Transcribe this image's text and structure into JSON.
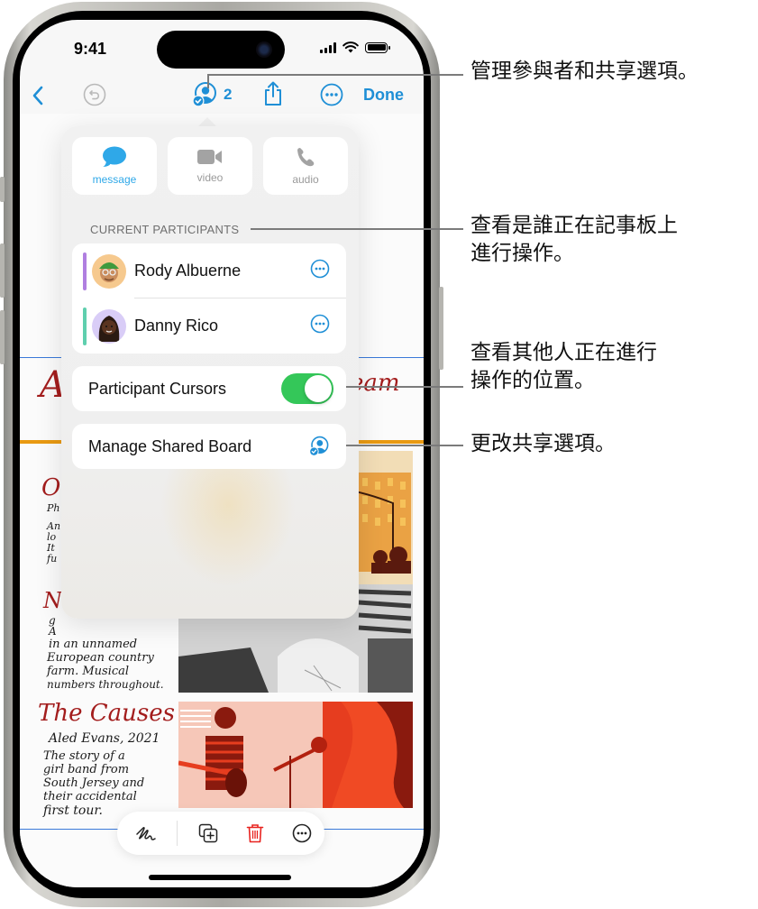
{
  "status_bar": {
    "time": "9:41",
    "icons": [
      "cellular-signal-icon",
      "wifi-icon",
      "battery-icon"
    ]
  },
  "nav_bar": {
    "back_icon": "chevron-left-icon",
    "undo_icon": "undo-icon",
    "collab_icon": "person-crop-circle-badge-checkmark-icon",
    "participant_count": "2",
    "share_icon": "share-icon",
    "more_icon": "ellipsis-circle-icon",
    "done_label": "Done"
  },
  "popover": {
    "communication_buttons": [
      {
        "label": "message",
        "icon": "message-bubble-icon",
        "active": true
      },
      {
        "label": "video",
        "icon": "video-camera-icon",
        "active": false
      },
      {
        "label": "audio",
        "icon": "phone-icon",
        "active": false
      }
    ],
    "participants_header": "CURRENT PARTICIPANTS",
    "participants": [
      {
        "name": "Rody Albuerne",
        "color": "#b07fe0",
        "avatar_bg": "#f6c98e",
        "more_icon": "ellipsis-circle-icon"
      },
      {
        "name": "Danny Rico",
        "color": "#5fcfae",
        "avatar_bg": "#d9cdf7",
        "more_icon": "ellipsis-circle-icon"
      }
    ],
    "participant_cursors": {
      "label": "Participant Cursors",
      "enabled": true
    },
    "manage_shared_board": {
      "label": "Manage Shared Board",
      "icon": "person-crop-circle-badge-checkmark-icon"
    }
  },
  "board": {
    "headings": [
      "A",
      "eam",
      "O",
      "N.",
      "The Causes"
    ],
    "notes": {
      "o_lines": [
        "Ph",
        "An",
        "lo",
        "It",
        "fu"
      ],
      "n_lines": [
        "g",
        "A",
        "in an unnamed",
        "European country",
        "farm. Musical",
        "numbers throughout."
      ],
      "causes_author": "Aled Evans, 2021",
      "causes_lines": [
        "The story of a",
        "girl band from",
        "South Jersey and",
        "their accidental",
        "first tour."
      ]
    }
  },
  "bottom_toolbar": {
    "items": [
      {
        "icon": "scribble-pen-icon"
      },
      {
        "icon": "duplicate-plus-icon"
      },
      {
        "icon": "trash-icon"
      },
      {
        "icon": "ellipsis-circle-icon"
      }
    ]
  },
  "callouts": [
    {
      "text": "管理參與者和共享選項。"
    },
    {
      "text": "查看是誰正在記事板上進行操作。",
      "lines": [
        "查看是誰正在記事板上",
        "進行操作。"
      ]
    },
    {
      "text": "查看其他人正在進行操作的位置。",
      "lines": [
        "查看其他人正在進行",
        "操作的位置。"
      ]
    },
    {
      "text": "更改共享選項。"
    }
  ],
  "colors": {
    "accent_blue": "#1f8fd6",
    "message_blue": "#2fa8e8",
    "toggle_green": "#34c759",
    "trash_red": "#e8231f",
    "heading_red": "#a31d1d",
    "orange_rule": "#e99a12"
  }
}
